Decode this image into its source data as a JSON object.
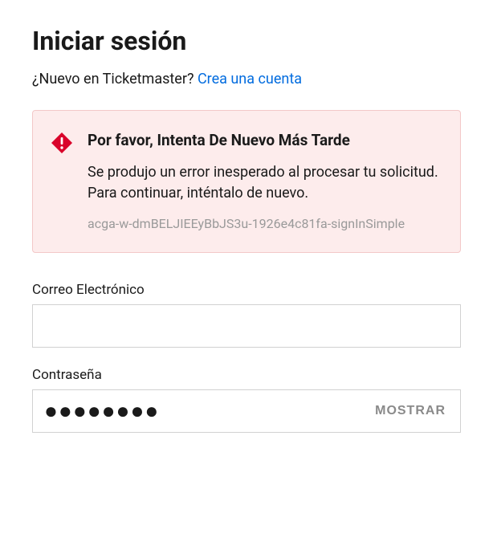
{
  "page_title": "Iniciar sesión",
  "signup": {
    "prompt": "¿Nuevo en Ticketmaster? ",
    "link_text": "Crea una cuenta"
  },
  "error": {
    "title": "Por favor, Intenta De Nuevo Más Tarde",
    "body": "Se produjo un error inesperado al procesar tu solicitud. Para continuar, inténtalo de nuevo.",
    "code": "acga-w-dmBELJIEEyBbJS3u-1926e4c81fa-signInSimple"
  },
  "email": {
    "label": "Correo Electrónico",
    "value": ""
  },
  "password": {
    "label": "Contraseña",
    "masked": "●●●●●●●●",
    "show_label": "MOSTRAR"
  },
  "colors": {
    "link": "#026cdf",
    "error_bg": "#fdecec",
    "error_border": "#f3c8c8",
    "error_icon": "#d9042b"
  }
}
